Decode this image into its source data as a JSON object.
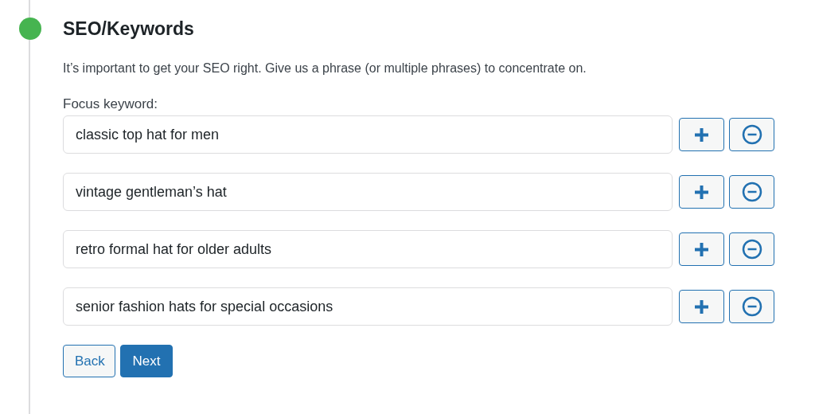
{
  "step": {
    "title": "SEO/Keywords",
    "completed": true
  },
  "description": "It’s important to get your SEO right. Give us a phrase (or multiple phrases) to concentrate on.",
  "field_label": "Focus keyword:",
  "keywords": [
    {
      "value": "classic top hat for men"
    },
    {
      "value": "vintage gentleman’s hat"
    },
    {
      "value": "retro formal hat for older adults"
    },
    {
      "value": "senior fashion hats for special occasions"
    }
  ],
  "buttons": {
    "back": "Back",
    "next": "Next"
  }
}
